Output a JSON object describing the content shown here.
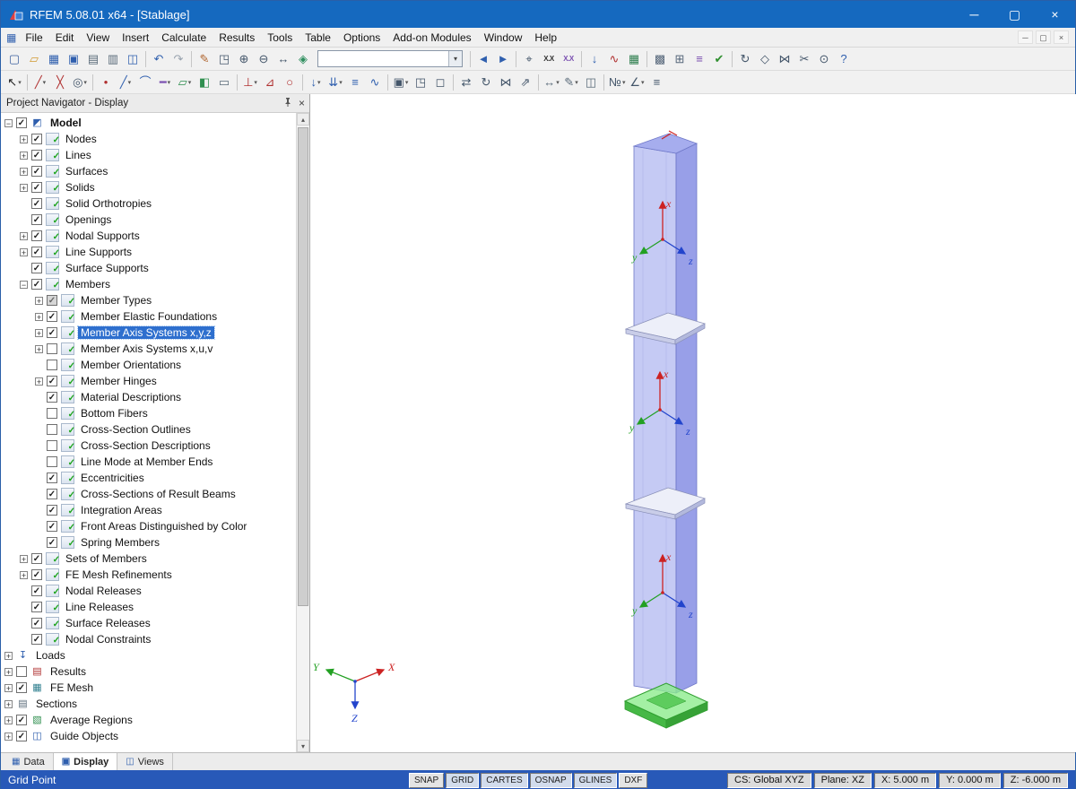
{
  "window": {
    "title": "RFEM 5.08.01 x64 - [Stablage]",
    "buttons": {
      "minimize": "─",
      "maximize": "▢",
      "close": "×"
    }
  },
  "menu": {
    "items": [
      "File",
      "Edit",
      "View",
      "Insert",
      "Calculate",
      "Results",
      "Tools",
      "Table",
      "Options",
      "Add-on Modules",
      "Window",
      "Help"
    ],
    "mdi": {
      "minimize": "─",
      "restore": "▢",
      "close": "×"
    }
  },
  "toolbar1": {
    "items": [
      {
        "t": "i",
        "n": "new-file",
        "g": "▢",
        "c": "#3a5f9e"
      },
      {
        "t": "i",
        "n": "open-file",
        "g": "▱",
        "c": "#d09a30"
      },
      {
        "t": "i",
        "n": "save-file",
        "g": "▦",
        "c": "#2f5fae"
      },
      {
        "t": "i",
        "n": "save-as",
        "g": "▣",
        "c": "#2f5fae"
      },
      {
        "t": "i",
        "n": "print",
        "g": "▤",
        "c": "#5a6b7a"
      },
      {
        "t": "i",
        "n": "print-preview",
        "g": "▥",
        "c": "#5a6b7a"
      },
      {
        "t": "i",
        "n": "copy-graphic",
        "g": "◫",
        "c": "#2f5fae"
      },
      {
        "t": "sep"
      },
      {
        "t": "i",
        "n": "undo",
        "g": "↶",
        "c": "#2f5fae"
      },
      {
        "t": "i",
        "n": "redo",
        "g": "↷",
        "c": "#98a2ae"
      },
      {
        "t": "sep"
      },
      {
        "t": "i",
        "n": "edit-comment",
        "g": "✎",
        "c": "#b0652f"
      },
      {
        "t": "i",
        "n": "zoom-window",
        "g": "◳",
        "c": "#44566a"
      },
      {
        "t": "i",
        "n": "zoom-in",
        "g": "⊕",
        "c": "#44566a"
      },
      {
        "t": "i",
        "n": "zoom-out",
        "g": "⊖",
        "c": "#44566a"
      },
      {
        "t": "i",
        "n": "pan-view",
        "g": "↔",
        "c": "#44566a"
      },
      {
        "t": "i",
        "n": "isometric-view",
        "g": "◈",
        "c": "#2f8f5f"
      },
      {
        "t": "combo",
        "n": "visibility-combobox"
      },
      {
        "t": "sep"
      },
      {
        "t": "i",
        "n": "previous-view",
        "g": "◄",
        "c": "#2f5fae"
      },
      {
        "t": "i",
        "n": "next-view",
        "g": "►",
        "c": "#2f5fae"
      },
      {
        "t": "sep"
      },
      {
        "t": "i",
        "n": "find-object",
        "g": "⌖",
        "c": "#44566a"
      },
      {
        "t": "i",
        "n": "node-numbering",
        "g": "X.X",
        "c": "#333333"
      },
      {
        "t": "i",
        "n": "member-numbering",
        "g": "X.X",
        "c": "#7a4fb0"
      },
      {
        "t": "sep"
      },
      {
        "t": "i",
        "n": "show-loads",
        "g": "↓",
        "c": "#2f5fae"
      },
      {
        "t": "i",
        "n": "show-results",
        "g": "∿",
        "c": "#b03030"
      },
      {
        "t": "i",
        "n": "result-tables",
        "g": "▦",
        "c": "#2f7f4f"
      },
      {
        "t": "sep"
      },
      {
        "t": "i",
        "n": "fe-mesh",
        "g": "▩",
        "c": "#55667a"
      },
      {
        "t": "i",
        "n": "mesh-refinement",
        "g": "⊞",
        "c": "#55667a"
      },
      {
        "t": "i",
        "n": "calculate",
        "g": "≡",
        "c": "#7a4fb0"
      },
      {
        "t": "i",
        "n": "check-model",
        "g": "✔",
        "c": "#2f8f2f"
      },
      {
        "t": "sep"
      },
      {
        "t": "i",
        "n": "rotate-view",
        "g": "↻",
        "c": "#44566a"
      },
      {
        "t": "i",
        "n": "perspective-view",
        "g": "◇",
        "c": "#44566a"
      },
      {
        "t": "i",
        "n": "mirror-view",
        "g": "⋈",
        "c": "#44566a"
      },
      {
        "t": "i",
        "n": "section-cut",
        "g": "✂",
        "c": "#44566a"
      },
      {
        "t": "i",
        "n": "info",
        "g": "⊙",
        "c": "#44566a"
      },
      {
        "t": "i",
        "n": "help",
        "g": "?",
        "c": "#2f5fae"
      }
    ]
  },
  "toolbar2": {
    "items": [
      {
        "t": "i",
        "n": "select-pointer",
        "g": "↖",
        "c": "#222222",
        "dd": true
      },
      {
        "t": "sep"
      },
      {
        "t": "i",
        "n": "edit-line",
        "g": "╱",
        "c": "#b03030",
        "dd": true
      },
      {
        "t": "i",
        "n": "divide-line",
        "g": "╳",
        "c": "#b03030"
      },
      {
        "t": "i",
        "n": "object-snap",
        "g": "◎",
        "c": "#44566a",
        "dd": true
      },
      {
        "t": "sep"
      },
      {
        "t": "i",
        "n": "new-node",
        "g": "•",
        "c": "#b03030"
      },
      {
        "t": "i",
        "n": "new-line",
        "g": "╱",
        "c": "#2f5fae",
        "dd": true
      },
      {
        "t": "i",
        "n": "new-arc",
        "g": "⌒",
        "c": "#2f5fae"
      },
      {
        "t": "i",
        "n": "new-member",
        "g": "━",
        "c": "#7a4fb0",
        "dd": true
      },
      {
        "t": "i",
        "n": "new-surface",
        "g": "▱",
        "c": "#2f8f4f",
        "dd": true
      },
      {
        "t": "i",
        "n": "new-solid",
        "g": "◧",
        "c": "#2f8f4f"
      },
      {
        "t": "i",
        "n": "new-opening",
        "g": "▭",
        "c": "#5a6b7a"
      },
      {
        "t": "sep"
      },
      {
        "t": "i",
        "n": "nodal-support",
        "g": "⊥",
        "c": "#b03030",
        "dd": true
      },
      {
        "t": "i",
        "n": "line-support",
        "g": "⊿",
        "c": "#b03030"
      },
      {
        "t": "i",
        "n": "member-hinge",
        "g": "○",
        "c": "#b03030"
      },
      {
        "t": "sep"
      },
      {
        "t": "i",
        "n": "nodal-load",
        "g": "↓",
        "c": "#2f5fae",
        "dd": true
      },
      {
        "t": "i",
        "n": "line-load",
        "g": "⇊",
        "c": "#2f5fae",
        "dd": true
      },
      {
        "t": "i",
        "n": "surface-load",
        "g": "≡",
        "c": "#2f5fae"
      },
      {
        "t": "i",
        "n": "imperfection",
        "g": "∿",
        "c": "#2f5fae"
      },
      {
        "t": "sep"
      },
      {
        "t": "i",
        "n": "select-all",
        "g": "▣",
        "c": "#44566a",
        "dd": true
      },
      {
        "t": "i",
        "n": "select-window",
        "g": "◳",
        "c": "#44566a"
      },
      {
        "t": "i",
        "n": "deselect",
        "g": "◻",
        "c": "#44566a"
      },
      {
        "t": "sep"
      },
      {
        "t": "i",
        "n": "move-copy",
        "g": "⇄",
        "c": "#44566a"
      },
      {
        "t": "i",
        "n": "rotate-objects",
        "g": "↻",
        "c": "#44566a"
      },
      {
        "t": "i",
        "n": "mirror-objects",
        "g": "⋈",
        "c": "#44566a"
      },
      {
        "t": "i",
        "n": "extrude",
        "g": "⇗",
        "c": "#44566a"
      },
      {
        "t": "sep"
      },
      {
        "t": "i",
        "n": "dimension",
        "g": "↔",
        "c": "#5a6b7a",
        "dd": true
      },
      {
        "t": "i",
        "n": "comment",
        "g": "✎",
        "c": "#5a6b7a",
        "dd": true
      },
      {
        "t": "i",
        "n": "guide-object",
        "g": "◫",
        "c": "#5a6b7a"
      },
      {
        "t": "sep"
      },
      {
        "t": "i",
        "n": "renumber",
        "g": "№",
        "c": "#44566a",
        "dd": true
      },
      {
        "t": "i",
        "n": "measure-angle",
        "g": "∠",
        "c": "#44566a",
        "dd": true
      },
      {
        "t": "i",
        "n": "layers",
        "g": "≡",
        "c": "#44566a"
      }
    ]
  },
  "navigator": {
    "title": "Project Navigator - Display",
    "icon_glyphs": {
      "model": {
        "g": "◩",
        "c": "#2f5fae"
      },
      "loads": {
        "g": "↧",
        "c": "#2f5fae"
      },
      "results": {
        "g": "▤",
        "c": "#b03030"
      },
      "femesh": {
        "g": "▦",
        "c": "#2f7f8f"
      },
      "sections": {
        "g": "▤",
        "c": "#5a6b7a"
      },
      "avg": {
        "g": "▧",
        "c": "#2f8f4f"
      },
      "guide": {
        "g": "◫",
        "c": "#2f5fae"
      }
    },
    "tree": [
      {
        "label": "Model",
        "lvl": 0,
        "exp": "minus",
        "chk": "on",
        "icon": "model",
        "bold": true
      },
      {
        "label": "Nodes",
        "lvl": 1,
        "exp": "plus",
        "chk": "on",
        "icon": "disp"
      },
      {
        "label": "Lines",
        "lvl": 1,
        "exp": "plus",
        "chk": "on",
        "icon": "disp"
      },
      {
        "label": "Surfaces",
        "lvl": 1,
        "exp": "plus",
        "chk": "on",
        "icon": "disp"
      },
      {
        "label": "Solids",
        "lvl": 1,
        "exp": "plus",
        "chk": "on",
        "icon": "disp"
      },
      {
        "label": "Solid Orthotropies",
        "lvl": 1,
        "exp": "none",
        "chk": "on",
        "icon": "disp"
      },
      {
        "label": "Openings",
        "lvl": 1,
        "exp": "none",
        "chk": "on",
        "icon": "disp"
      },
      {
        "label": "Nodal Supports",
        "lvl": 1,
        "exp": "plus",
        "chk": "on",
        "icon": "disp"
      },
      {
        "label": "Line Supports",
        "lvl": 1,
        "exp": "plus",
        "chk": "on",
        "icon": "disp"
      },
      {
        "label": "Surface Supports",
        "lvl": 1,
        "exp": "none",
        "chk": "on",
        "icon": "disp"
      },
      {
        "label": "Members",
        "lvl": 1,
        "exp": "minus",
        "chk": "on",
        "icon": "disp"
      },
      {
        "label": "Member Types",
        "lvl": 2,
        "exp": "plus",
        "chk": "gray",
        "icon": "disp"
      },
      {
        "label": "Member Elastic Foundations",
        "lvl": 2,
        "exp": "plus",
        "chk": "on",
        "icon": "disp"
      },
      {
        "label": "Member Axis Systems x,y,z",
        "lvl": 2,
        "exp": "plus",
        "chk": "on",
        "icon": "disp",
        "selected": true
      },
      {
        "label": "Member Axis Systems x,u,v",
        "lvl": 2,
        "exp": "plus",
        "chk": "off",
        "icon": "disp"
      },
      {
        "label": "Member Orientations",
        "lvl": 2,
        "exp": "none",
        "chk": "off",
        "icon": "disp"
      },
      {
        "label": "Member Hinges",
        "lvl": 2,
        "exp": "plus",
        "chk": "on",
        "icon": "disp"
      },
      {
        "label": "Material Descriptions",
        "lvl": 2,
        "exp": "none",
        "chk": "on",
        "icon": "disp"
      },
      {
        "label": "Bottom Fibers",
        "lvl": 2,
        "exp": "none",
        "chk": "off",
        "icon": "disp"
      },
      {
        "label": "Cross-Section Outlines",
        "lvl": 2,
        "exp": "none",
        "chk": "off",
        "icon": "disp"
      },
      {
        "label": "Cross-Section Descriptions",
        "lvl": 2,
        "exp": "none",
        "chk": "off",
        "icon": "disp"
      },
      {
        "label": "Line Mode at Member Ends",
        "lvl": 2,
        "exp": "none",
        "chk": "off",
        "icon": "disp"
      },
      {
        "label": "Eccentricities",
        "lvl": 2,
        "exp": "none",
        "chk": "on",
        "icon": "disp"
      },
      {
        "label": "Cross-Sections of Result Beams",
        "lvl": 2,
        "exp": "none",
        "chk": "on",
        "icon": "disp"
      },
      {
        "label": "Integration Areas",
        "lvl": 2,
        "exp": "none",
        "chk": "on",
        "icon": "disp"
      },
      {
        "label": "Front Areas Distinguished by Color",
        "lvl": 2,
        "exp": "none",
        "chk": "on",
        "icon": "disp"
      },
      {
        "label": "Spring Members",
        "lvl": 2,
        "exp": "none",
        "chk": "on",
        "icon": "disp"
      },
      {
        "label": "Sets of Members",
        "lvl": 1,
        "exp": "plus",
        "chk": "on",
        "icon": "disp"
      },
      {
        "label": "FE Mesh Refinements",
        "lvl": 1,
        "exp": "plus",
        "chk": "on",
        "icon": "disp"
      },
      {
        "label": "Nodal Releases",
        "lvl": 1,
        "exp": "none",
        "chk": "on",
        "icon": "disp"
      },
      {
        "label": "Line Releases",
        "lvl": 1,
        "exp": "none",
        "chk": "on",
        "icon": "disp"
      },
      {
        "label": "Surface Releases",
        "lvl": 1,
        "exp": "none",
        "chk": "on",
        "icon": "disp"
      },
      {
        "label": "Nodal Constraints",
        "lvl": 1,
        "exp": "none",
        "chk": "on",
        "icon": "disp"
      },
      {
        "label": "Loads",
        "lvl": 0,
        "exp": "plus",
        "chk": "none",
        "icon": "loads"
      },
      {
        "label": "Results",
        "lvl": 0,
        "exp": "plus",
        "chk": "off",
        "icon": "results"
      },
      {
        "label": "FE Mesh",
        "lvl": 0,
        "exp": "plus",
        "chk": "on",
        "icon": "femesh"
      },
      {
        "label": "Sections",
        "lvl": 0,
        "exp": "plus",
        "chk": "none",
        "icon": "sections"
      },
      {
        "label": "Average Regions",
        "lvl": 0,
        "exp": "plus",
        "chk": "on",
        "icon": "avg"
      },
      {
        "label": "Guide Objects",
        "lvl": 0,
        "exp": "plus",
        "chk": "on",
        "icon": "guide"
      }
    ],
    "tabs": [
      {
        "label": "Data",
        "g": "▦",
        "c": "#2f5fae",
        "active": false
      },
      {
        "label": "Display",
        "g": "▣",
        "c": "#2f5fae",
        "active": true
      },
      {
        "label": "Views",
        "g": "◫",
        "c": "#2f5fae",
        "active": false
      }
    ]
  },
  "viewport": {
    "member_axes": {
      "x": "x",
      "y": "y",
      "z": "z"
    },
    "global_axes": {
      "x": "X",
      "y": "Y",
      "z": "Z"
    }
  },
  "statusbar": {
    "left": "Grid Point",
    "toggles": [
      {
        "label": "SNAP",
        "active": false
      },
      {
        "label": "GRID",
        "active": true
      },
      {
        "label": "CARTES",
        "active": true
      },
      {
        "label": "OSNAP",
        "active": true
      },
      {
        "label": "GLINES",
        "active": true
      },
      {
        "label": "DXF",
        "active": false
      }
    ],
    "fields": [
      {
        "n": "coordinate-system-field",
        "label": "CS: Global XYZ"
      },
      {
        "n": "work-plane-field",
        "label": "Plane: XZ"
      },
      {
        "n": "x-coordinate-field",
        "label": "X:  5.000 m"
      },
      {
        "n": "y-coordinate-field",
        "label": "Y:  0.000 m"
      },
      {
        "n": "z-coordinate-field",
        "label": "Z: -6.000 m"
      }
    ]
  }
}
